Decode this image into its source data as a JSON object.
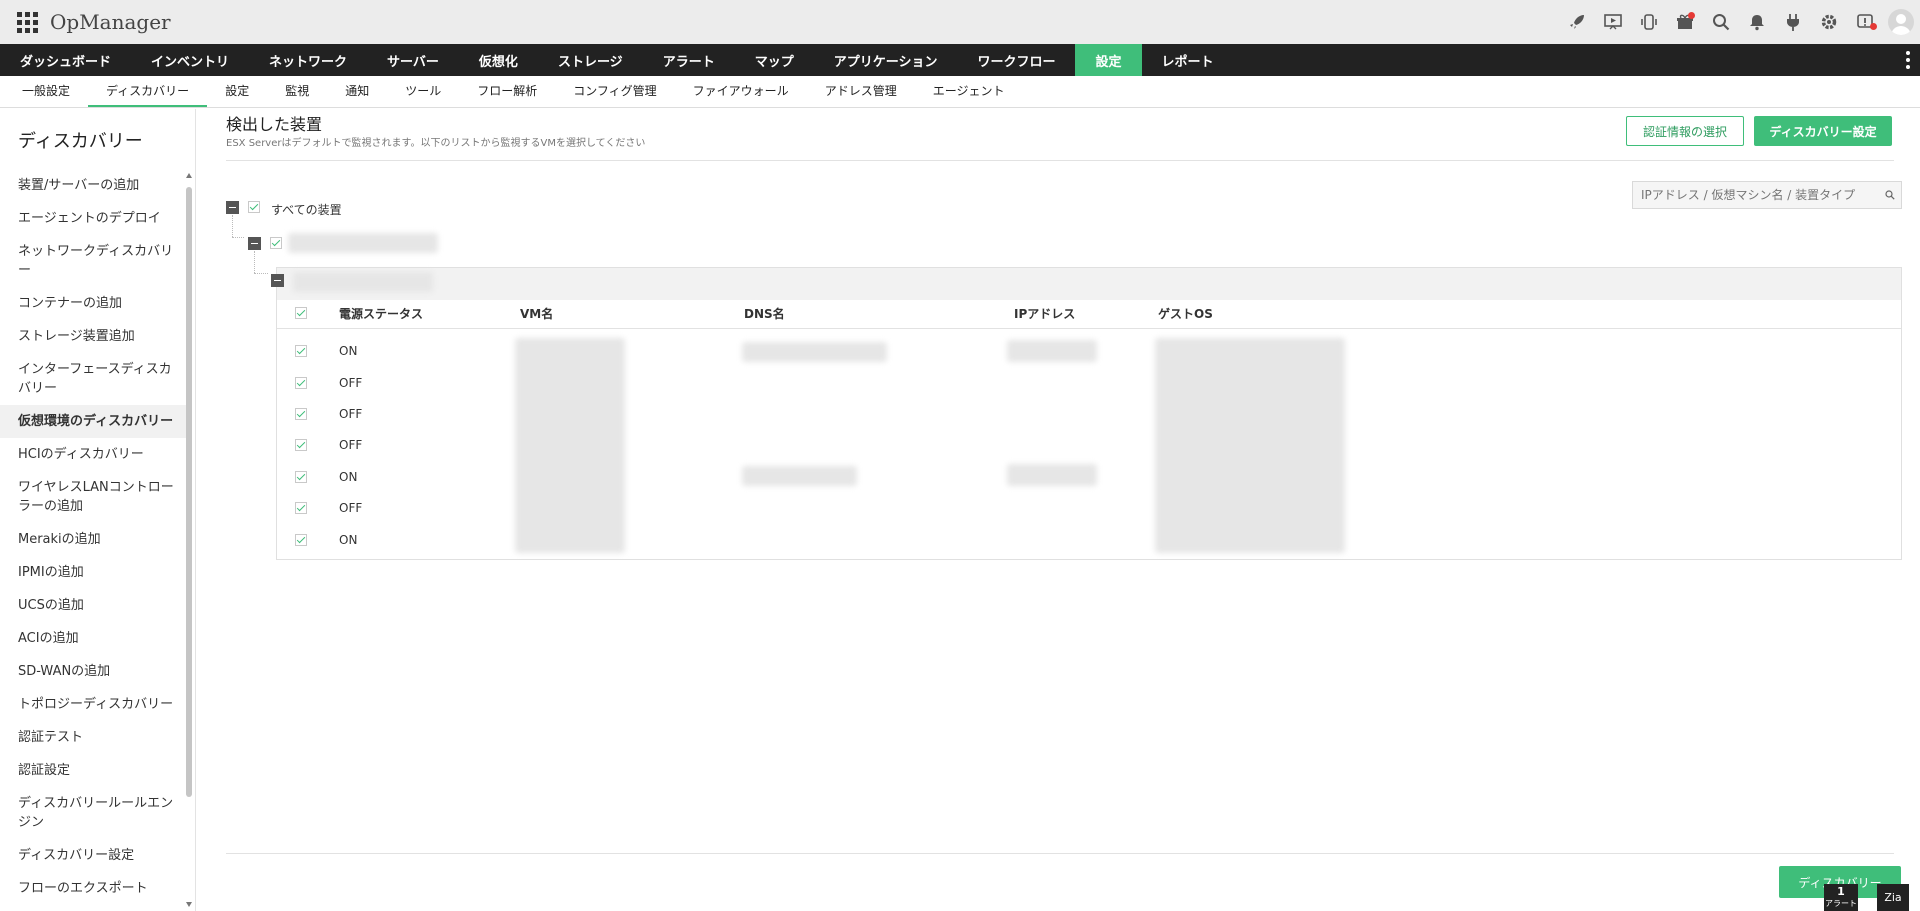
{
  "app": {
    "title": "OpManager"
  },
  "top_icons": [
    "rocket-icon",
    "presentation-icon",
    "phone-icon",
    "gift-icon",
    "search-icon",
    "bell-icon",
    "plug-icon",
    "gear-icon",
    "alert-shield-icon",
    "user-avatar"
  ],
  "main_nav": [
    {
      "label": "ダッシュボード",
      "active": false
    },
    {
      "label": "インベントリ",
      "active": false
    },
    {
      "label": "ネットワーク",
      "active": false
    },
    {
      "label": "サーバー",
      "active": false
    },
    {
      "label": "仮想化",
      "active": false
    },
    {
      "label": "ストレージ",
      "active": false
    },
    {
      "label": "アラート",
      "active": false
    },
    {
      "label": "マップ",
      "active": false
    },
    {
      "label": "アプリケーション",
      "active": false
    },
    {
      "label": "ワークフロー",
      "active": false
    },
    {
      "label": "設定",
      "active": true
    },
    {
      "label": "レポート",
      "active": false
    }
  ],
  "sub_nav": [
    {
      "label": "一般設定",
      "active": false
    },
    {
      "label": "ディスカバリー",
      "active": true
    },
    {
      "label": "設定",
      "active": false
    },
    {
      "label": "監視",
      "active": false
    },
    {
      "label": "通知",
      "active": false
    },
    {
      "label": "ツール",
      "active": false
    },
    {
      "label": "フロー解析",
      "active": false
    },
    {
      "label": "コンフィグ管理",
      "active": false
    },
    {
      "label": "ファイアウォール",
      "active": false
    },
    {
      "label": "アドレス管理",
      "active": false
    },
    {
      "label": "エージェント",
      "active": false
    }
  ],
  "sidebar": {
    "title": "ディスカバリー",
    "items": [
      {
        "label": "装置/サーバーの追加",
        "active": false
      },
      {
        "label": "エージェントのデプロイ",
        "active": false
      },
      {
        "label": "ネットワークディスカバリー",
        "active": false
      },
      {
        "label": "コンテナーの追加",
        "active": false
      },
      {
        "label": "ストレージ装置追加",
        "active": false
      },
      {
        "label": "インターフェースディスカバリー",
        "active": false
      },
      {
        "label": "仮想環境のディスカバリー",
        "active": true
      },
      {
        "label": "HCIのディスカバリー",
        "active": false
      },
      {
        "label": "ワイヤレスLANコントローラーの追加",
        "active": false
      },
      {
        "label": "Merakiの追加",
        "active": false
      },
      {
        "label": "IPMIの追加",
        "active": false
      },
      {
        "label": "UCSの追加",
        "active": false
      },
      {
        "label": "ACIの追加",
        "active": false
      },
      {
        "label": "SD-WANの追加",
        "active": false
      },
      {
        "label": "トポロジーディスカバリー",
        "active": false
      },
      {
        "label": "認証テスト",
        "active": false
      },
      {
        "label": "認証設定",
        "active": false
      },
      {
        "label": "ディスカバリールールエンジン",
        "active": false
      },
      {
        "label": "ディスカバリー設定",
        "active": false
      },
      {
        "label": "フローのエクスポート",
        "active": false
      }
    ]
  },
  "content": {
    "title": "検出した装置",
    "subtitle": "ESX Serverはデフォルトで監視されます。以下のリストから監視するVMを選択してください",
    "credential_button": "認証情報の選択",
    "discovery_settings_button": "ディスカバリー設定",
    "search_placeholder": "IPアドレス / 仮想マシン名 / 装置タイプ",
    "tree_root_label": "すべての装置",
    "columns": [
      "電源ステータス",
      "VM名",
      "DNS名",
      "IPアドレス",
      "ゲストOS"
    ],
    "rows": [
      {
        "power": "ON"
      },
      {
        "power": "OFF"
      },
      {
        "power": "OFF"
      },
      {
        "power": "OFF"
      },
      {
        "power": "ON"
      },
      {
        "power": "OFF"
      },
      {
        "power": "ON"
      }
    ],
    "discover_button": "ディスカバリー"
  },
  "footer_badges": {
    "alert_count": "1",
    "alert_label": "アラート",
    "zia_label": "Zia"
  },
  "colors": {
    "accent": "#3fbe7a",
    "nav_bg": "#222222",
    "topbar_bg": "#ececec"
  }
}
